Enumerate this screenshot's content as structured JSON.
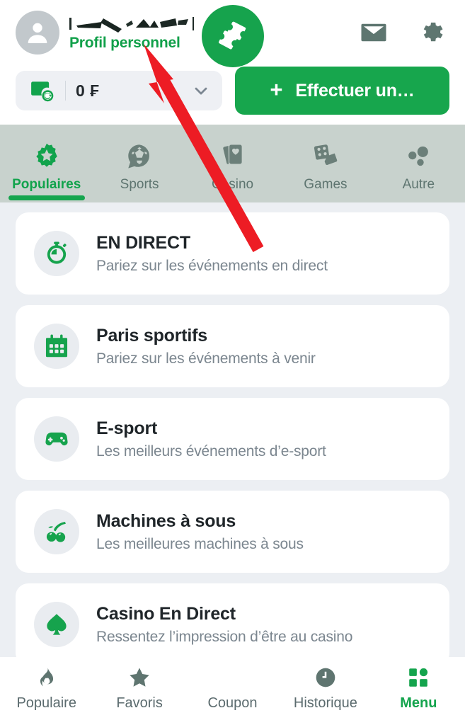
{
  "header": {
    "avatar_icon": "user-avatar-icon",
    "username_redacted": true,
    "profile_link_label": "Profil personnel",
    "mail_icon": "envelope-icon",
    "settings_icon": "gear-icon",
    "balance": {
      "wallet_icon": "wallet-refresh-icon",
      "amount": "0 ₣",
      "chevron_icon": "chevron-down-icon"
    },
    "deposit_button": {
      "plus": "+",
      "label": "Effectuer un…"
    }
  },
  "category_tabs": [
    {
      "label": "Populaires",
      "icon": "star-badge-icon",
      "active": true
    },
    {
      "label": "Sports",
      "icon": "soccer-ball-icon",
      "active": false
    },
    {
      "label": "Casino",
      "icon": "playing-cards-icon",
      "active": false
    },
    {
      "label": "Games",
      "icon": "dice-icon",
      "active": false
    },
    {
      "label": "Autre",
      "icon": "three-dots-icon",
      "active": false
    }
  ],
  "list_items": [
    {
      "title": "EN DIRECT",
      "subtitle": "Pariez sur les événements en direct",
      "icon": "stopwatch-icon"
    },
    {
      "title": "Paris sportifs",
      "subtitle": "Pariez sur les événements à venir",
      "icon": "calendar-icon"
    },
    {
      "title": "E-sport",
      "subtitle": "Les meilleurs événements d’e-sport",
      "icon": "gamepad-icon"
    },
    {
      "title": "Machines à sous",
      "subtitle": "Les meilleures machines à sous",
      "icon": "cherries-icon"
    },
    {
      "title": "Casino En Direct",
      "subtitle": "Ressentez l’impression d’être au casino",
      "icon": "spade-icon"
    }
  ],
  "bottom_nav": [
    {
      "label": "Populaire",
      "icon": "flame-icon",
      "active": false
    },
    {
      "label": "Favoris",
      "icon": "star-icon",
      "active": false
    },
    {
      "label": "Coupon",
      "icon": "ticket-icon",
      "active": false,
      "is_fab": true
    },
    {
      "label": "Historique",
      "icon": "clock-icon",
      "active": false
    },
    {
      "label": "Menu",
      "icon": "grid-menu-icon",
      "active": true
    }
  ],
  "annotation": {
    "type": "arrow",
    "color": "#ed1c24",
    "points_to": "Profil personnel"
  },
  "colors": {
    "brand_green": "#16a34d",
    "page_bg": "#eceff3",
    "tab_bar_bg": "#c8d2cd",
    "card_bg": "#ffffff",
    "muted_text": "#7b868f",
    "icon_gray": "#5e7570"
  }
}
